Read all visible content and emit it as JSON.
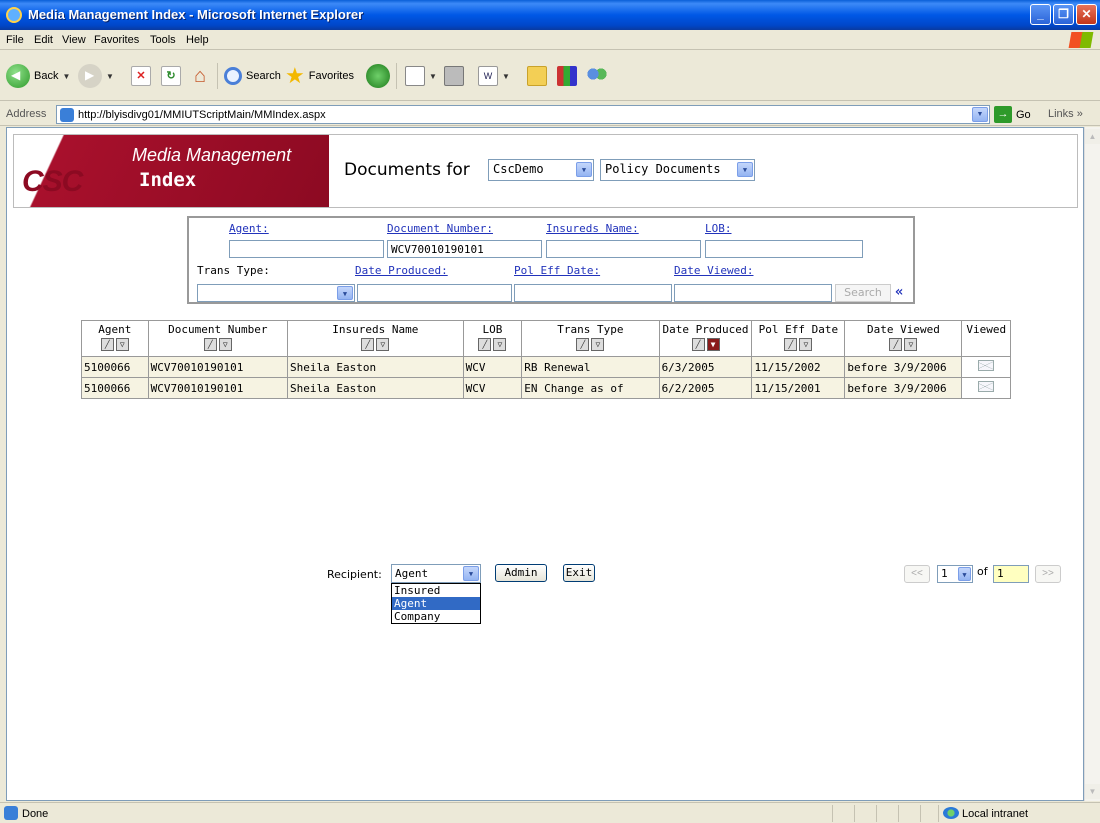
{
  "window": {
    "title": "Media Management Index - Microsoft Internet Explorer"
  },
  "menu": [
    "File",
    "Edit",
    "View",
    "Favorites",
    "Tools",
    "Help"
  ],
  "toolbar": {
    "back": "Back",
    "search": "Search",
    "favorites": "Favorites"
  },
  "address": {
    "label": "Address",
    "url": "http://blyisdivg01/MMIUTScriptMain/MMIndex.aspx",
    "go": "Go",
    "links": "Links"
  },
  "header": {
    "logo": "CSC",
    "title": "Media Management",
    "subtitle": "Index",
    "documents_for": "Documents for",
    "company_select": "CscDemo",
    "doctype_select": "Policy Documents"
  },
  "search": {
    "labels": {
      "agent": "Agent:",
      "document_number": "Document Number:",
      "insureds_name": "Insureds Name:",
      "lob": "LOB:",
      "trans_type": "Trans Type:",
      "date_produced": "Date Produced:",
      "pol_eff_date": "Pol Eff Date:",
      "date_viewed": "Date Viewed:"
    },
    "values": {
      "agent": "",
      "document_number": "WCV70010190101",
      "insureds_name": "",
      "lob": "",
      "trans_type": "",
      "date_produced": "",
      "pol_eff_date": "",
      "date_viewed": ""
    },
    "search_button": "Search",
    "collapse": "«"
  },
  "table": {
    "columns": [
      "Agent",
      "Document Number",
      "Insureds Name",
      "LOB",
      "Trans Type",
      "Date Produced",
      "Pol Eff Date",
      "Date Viewed",
      "Viewed"
    ],
    "rows": [
      [
        "5100066",
        "WCV70010190101",
        "Sheila Easton",
        "WCV",
        "RB Renewal",
        "6/3/2005",
        "11/15/2002",
        "before 3/9/2006"
      ],
      [
        "5100066",
        "WCV70010190101",
        "Sheila Easton",
        "WCV",
        "EN Change as of",
        "6/2/2005",
        "11/15/2001",
        "before 3/9/2006"
      ]
    ]
  },
  "bottom": {
    "recipient_label": "Recipient:",
    "recipient_value": "Agent",
    "recipient_options": [
      "Insured",
      "Agent",
      "Company"
    ],
    "admin": "Admin",
    "exit": "Exit"
  },
  "pager": {
    "prev": "<<",
    "next": ">>",
    "page": "1",
    "of": "of",
    "total": "1"
  },
  "status": {
    "text": "Done",
    "zone": "Local intranet"
  }
}
